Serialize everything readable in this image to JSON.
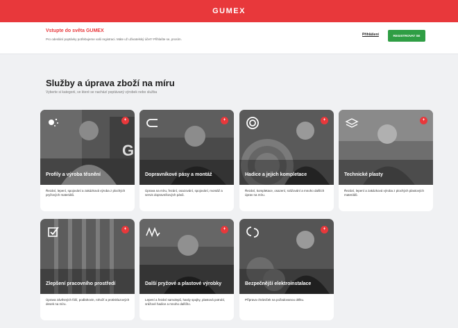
{
  "brand": {
    "logo": "GUMEX",
    "accent": "#e8383b",
    "cta_color": "#2f9e44"
  },
  "promo": {
    "title": "Vstupte do světa GUMEX",
    "text": "Pro odeslání poptávky potřebujeme vaši registraci. Máte už uživatelský účet? Přihlašte se, prosím.",
    "login_label": "Přihlášení",
    "register_label": "REGISTROVAT SE"
  },
  "page": {
    "heading": "Služby a úprava zboží na míru",
    "subheading": "Vyberte si kategorii, ve které se nachází poptávaný výrobek nebo služba"
  },
  "cards": [
    {
      "title": "Profily a výroba těsnění",
      "icon": "sparkle-icon",
      "badge": "+",
      "description": "Řezání, lepení, spojování a zakázková výroba z plochých pryžových materiálů."
    },
    {
      "title": "Dopravníkové pásy a montáž",
      "icon": "conveyor-icon",
      "badge": "+",
      "description": "Úprava na míru, řezání, osazování, spojování, montáž a servis dopravníkových pásů."
    },
    {
      "title": "Hadice a jejich kompletace",
      "icon": "hose-coil-icon",
      "badge": "+",
      "description": "Řezání, kompletace, osazení, srážování a mnoho dalších úprav na míru."
    },
    {
      "title": "Technické plasty",
      "icon": "layers-icon",
      "badge": "+",
      "description": "Řezání, lepení a zakázková výroba z plochých plastových materiálů."
    },
    {
      "title": "Zlepšení pracovního prostředí",
      "icon": "checkbox-icon",
      "badge": "+",
      "description": "Úprava závěsných fólií, podlahovin, rohoží a protiskluzových desek na míru."
    },
    {
      "title": "Další pryžové a plastové výrobky",
      "icon": "wave-icon",
      "badge": "+",
      "description": "Lepení a řezání samolepů, hardy spojky, plastová potrubí, srážové hadice a mnoho dalšího."
    },
    {
      "title": "Bezpečnější elektroinstalace",
      "icon": "cable-loop-icon",
      "badge": "+",
      "description": "Příprava chrániček na požadovanou délku."
    }
  ]
}
